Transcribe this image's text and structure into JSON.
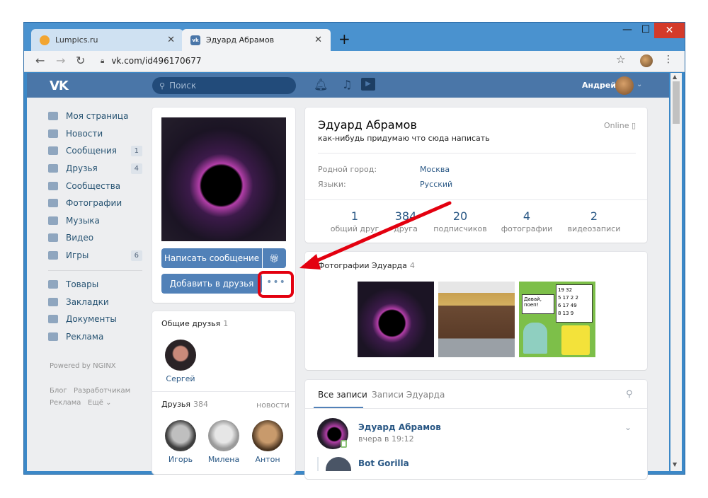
{
  "browser": {
    "tabs": [
      {
        "title": "Lumpics.ru",
        "active": false
      },
      {
        "title": "Эдуард Абрамов",
        "active": true
      }
    ],
    "new_tab": "+",
    "close_tab": "✕",
    "url": "vk.com/id496170677",
    "window_controls": {
      "minimize": "—",
      "maximize": "☐",
      "close": "✕"
    }
  },
  "vk_header": {
    "logo": "VK",
    "search_placeholder": "Поиск",
    "user_name": "Андрей"
  },
  "left_menu": {
    "items": [
      {
        "label": "Моя страница",
        "icon": "home-icon"
      },
      {
        "label": "Новости",
        "icon": "news-icon"
      },
      {
        "label": "Сообщения",
        "icon": "messages-icon",
        "count": "1"
      },
      {
        "label": "Друзья",
        "icon": "friends-icon",
        "count": "4"
      },
      {
        "label": "Сообщества",
        "icon": "groups-icon"
      },
      {
        "label": "Фотографии",
        "icon": "camera-icon"
      },
      {
        "label": "Музыка",
        "icon": "music-icon"
      },
      {
        "label": "Видео",
        "icon": "video-icon"
      },
      {
        "label": "Игры",
        "icon": "games-icon",
        "count": "6"
      }
    ],
    "items2": [
      {
        "label": "Товары",
        "icon": "shop-icon"
      },
      {
        "label": "Закладки",
        "icon": "star-icon"
      },
      {
        "label": "Документы",
        "icon": "document-icon"
      },
      {
        "label": "Реклама",
        "icon": "ads-icon"
      }
    ],
    "powered": "Powered by NGINX",
    "footer": {
      "blog": "Блог",
      "dev": "Разработчикам",
      "ads": "Реклама",
      "more": "Ещё ⌄"
    }
  },
  "profile": {
    "buttons": {
      "message": "Написать сообщение",
      "add_friend": "Добавить в друзья",
      "more": "•••"
    },
    "mutual": {
      "title": "Общие друзья",
      "count": "1",
      "friends": [
        {
          "name": "Сергей"
        }
      ]
    },
    "friends": {
      "title": "Друзья",
      "count": "384",
      "link": "новости",
      "list": [
        {
          "name": "Игорь"
        },
        {
          "name": "Милена"
        },
        {
          "name": "Антон"
        }
      ]
    },
    "name": "Эдуард Абрамов",
    "status": "как-нибудь придумаю что сюда написать",
    "online": "Online",
    "info": [
      {
        "label": "Родной город:",
        "value": "Москва"
      },
      {
        "label": "Языки:",
        "value": "Русский"
      }
    ],
    "counters": [
      {
        "num": "1",
        "label": "общий друг"
      },
      {
        "num": "384",
        "label": "друга"
      },
      {
        "num": "20",
        "label": "подписчиков"
      },
      {
        "num": "4",
        "label": "фотографии"
      },
      {
        "num": "2",
        "label": "видеозаписи"
      }
    ],
    "photos": {
      "title": "Фотографии Эдуарда",
      "count": "4"
    },
    "wall": {
      "tab_all": "Все записи",
      "tab_user": "Записи Эдуарда",
      "post_author": "Эдуард Абрамов",
      "post_time": "вчера в 19:12",
      "repost_author": "Bot Gorilla"
    }
  },
  "meme_text": [
    "Давай, поеп!",
    "19 32",
    "5 17 2 2",
    "6 17 49",
    "8 13 9"
  ],
  "colors": {
    "vk_blue": "#4a76a8",
    "button_blue": "#5181b8",
    "link": "#2a5885",
    "highlight_red": "#e3000f"
  }
}
